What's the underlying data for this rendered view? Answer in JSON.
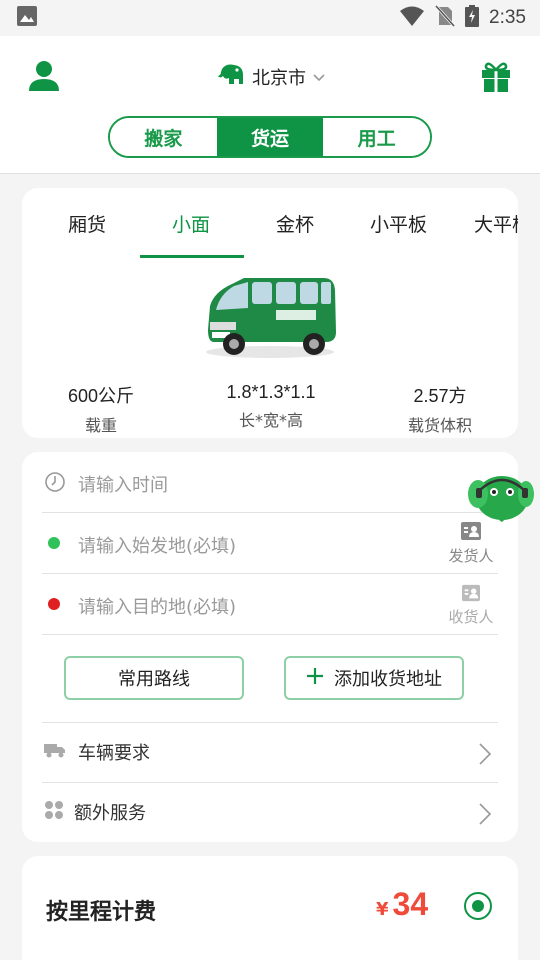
{
  "status_bar": {
    "time": "2:35"
  },
  "header": {
    "city": "北京市",
    "segments": [
      {
        "label": "搬家",
        "active": false
      },
      {
        "label": "货运",
        "active": true
      },
      {
        "label": "用工",
        "active": false
      }
    ]
  },
  "vehicle": {
    "tabs": [
      "厢货",
      "小面",
      "金杯",
      "小平板",
      "大平板"
    ],
    "active_tab": "小面",
    "specs": [
      {
        "value": "600公斤",
        "label": "载重"
      },
      {
        "value": "1.8*1.3*1.1",
        "label": "长*宽*高"
      },
      {
        "value": "2.57方",
        "label": "载货体积"
      }
    ]
  },
  "form": {
    "time_placeholder": "请输入时间",
    "origin_placeholder": "请输入始发地(必填)",
    "origin_contact": "发货人",
    "dest_placeholder": "请输入目的地(必填)",
    "dest_contact": "收货人",
    "common_routes_label": "常用路线",
    "add_address_label": "添加收货地址",
    "vehicle_req_label": "车辆要求",
    "extra_service_label": "额外服务"
  },
  "pricing": {
    "title": "按里程计费",
    "currency": "¥",
    "amount": "34",
    "selected": true
  },
  "colors": {
    "brand_green": "#0e9444",
    "price_red": "#f04a3a",
    "origin_dot": "#2fc25b",
    "dest_dot": "#e02020"
  }
}
